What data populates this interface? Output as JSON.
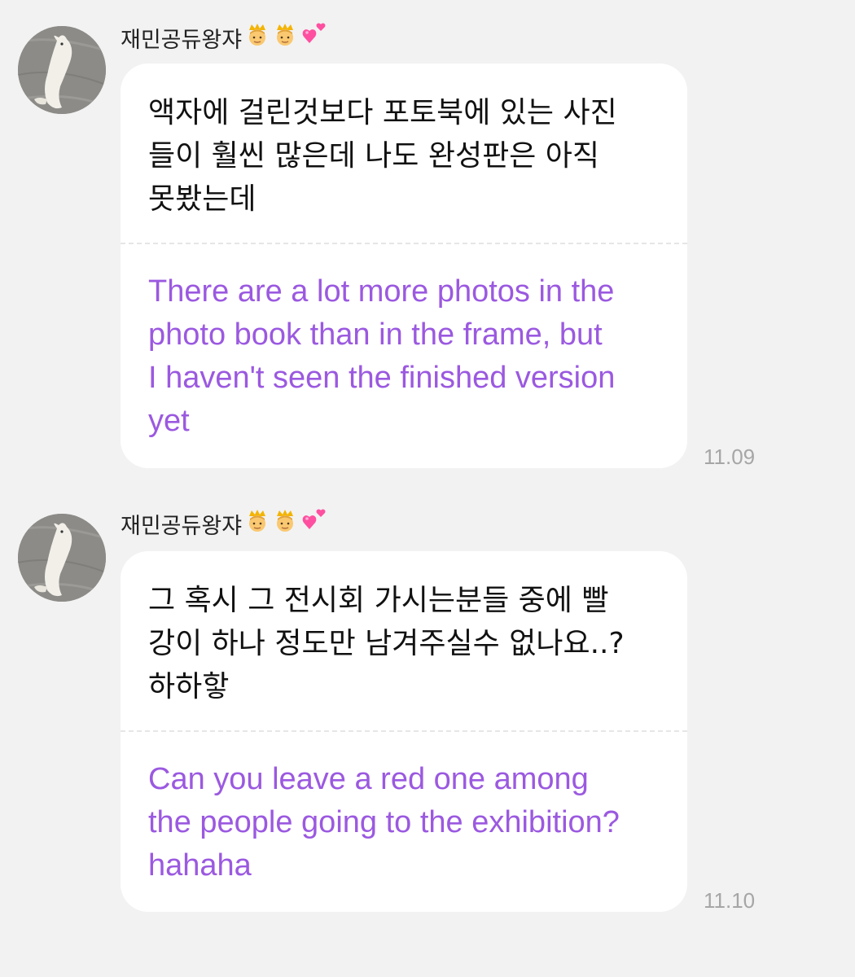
{
  "messages": [
    {
      "sender": "재민공듀왕쟈",
      "emojis": [
        "prince-emoji",
        "prince-emoji",
        "two-hearts-emoji"
      ],
      "original_text": "액자에 걸린것보다 포토북에 있는 사진\n들이 훨씬 많은데 나도 완성판은 아직\n못봤는데",
      "translated_text": "There are a lot more photos in the\nphoto book than in the frame, but\nI haven't seen the finished version\nyet",
      "time": "11.09"
    },
    {
      "sender": "재민공듀왕쟈",
      "emojis": [
        "prince-emoji",
        "prince-emoji",
        "two-hearts-emoji"
      ],
      "original_text": "그 혹시 그 전시회 가시는분들 중에 빨\n강이 하나 정도만 남겨주실수 없나요..?\n하하핳",
      "translated_text": "Can you leave a red one among\nthe people going to the exhibition?\nhahaha",
      "time": "11.10"
    }
  ],
  "colors": {
    "background": "#f2f2f2",
    "bubble": "#ffffff",
    "translation_text": "#9b59e0",
    "timestamp": "#a6a6a6"
  }
}
